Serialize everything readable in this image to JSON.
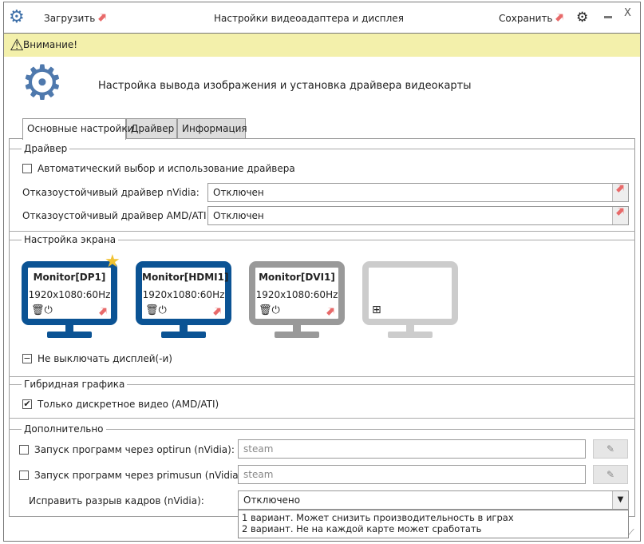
{
  "titlebar": {
    "title": "Настройки видеоадаптера и дисплея",
    "load": "Загрузить",
    "save": "Сохранить",
    "close": "X"
  },
  "warning": "Внимание!",
  "header": "Настройка вывода изображения и установка драйвера видеокарты",
  "tabs": [
    "Основные настройки",
    "Драйвер",
    "Информация"
  ],
  "driver": {
    "title": "Драйвер",
    "auto": "Автоматический выбор и использование драйвера",
    "nvidia_label": "Отказоустойчивый драйвер nVidia:",
    "nvidia_value": "Отключен",
    "amd_label": "Отказоустойчивый драйвер AMD/ATI:",
    "amd_value": "Отключен"
  },
  "screen": {
    "title": "Настройка экрана",
    "monitors": [
      {
        "name": "Monitor[DP1]",
        "res": "1920x1080:60Hz",
        "color": "#0b5394"
      },
      {
        "name": "Monitor[HDMI1]",
        "res": "1920x1080:60Hz",
        "color": "#0b5394"
      },
      {
        "name": "Monitor[DVI1]",
        "res": "1920x1080:60Hz",
        "color": "#999999"
      }
    ],
    "no_off": "Не выключать дисплей(-и)"
  },
  "hybrid": {
    "title": "Гибридная графика",
    "discrete": "Только дискретное видео (AMD/ATI)"
  },
  "extra": {
    "title": "Дополнительно",
    "optirun": "Запуск программ через optirun (nVidia):",
    "optirun_value": "steam",
    "primusun": "Запуск программ через primusun (nVidia):",
    "primusun_value": "steam",
    "tearing": "Исправить разрыв кадров (nVidia):",
    "tearing_value": "Отключено",
    "options": [
      "1 вариант. Может снизить производительность в играх",
      "2 вариант. Не на каждой карте может сработать"
    ]
  }
}
